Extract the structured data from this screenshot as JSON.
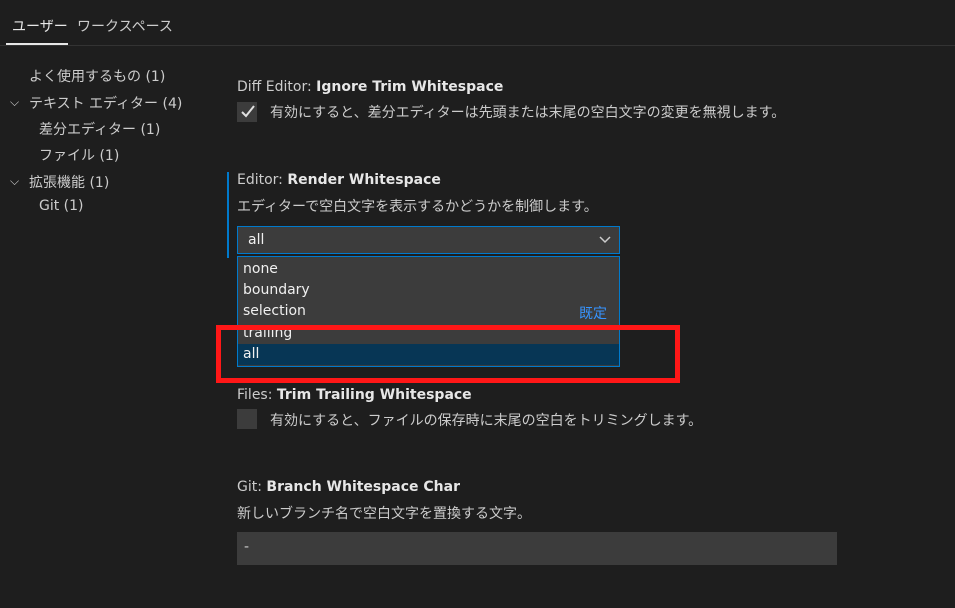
{
  "tabs": [
    {
      "label": "ユーザー",
      "active": true
    },
    {
      "label": "ワークスペース",
      "active": false
    }
  ],
  "tree": [
    {
      "label": "よく使用するもの (1)"
    },
    {
      "label": "テキスト エディター (4)",
      "expanded": true
    },
    {
      "label": "差分エディター (1)"
    },
    {
      "label": "ファイル (1)"
    },
    {
      "label": "拡張機能 (1)",
      "expanded": true
    },
    {
      "label": "Git (1)"
    }
  ],
  "settings": {
    "diff": {
      "category": "Diff Editor: ",
      "name": "Ignore Trim Whitespace",
      "checked": true,
      "description": "有効にすると、差分エディターは先頭または末尾の空白文字の変更を無視します。"
    },
    "render": {
      "category": "Editor: ",
      "name": "Render Whitespace",
      "description": "エディターで空白文字を表示するかどうかを制御します。",
      "value": "all",
      "options": [
        "none",
        "boundary",
        "selection",
        "trailing",
        "all"
      ],
      "default_label": "既定",
      "default_option": "selection"
    },
    "files": {
      "category": "Files: ",
      "name": "Trim Trailing Whitespace",
      "checked": false,
      "description": "有効にすると、ファイルの保存時に末尾の空白をトリミングします。"
    },
    "git": {
      "category": "Git: ",
      "name": "Branch Whitespace Char",
      "description": "新しいブランチ名で空白文字を置換する文字。",
      "value": "-"
    }
  },
  "colors": {
    "accent": "#007acc",
    "selected_option": "#073655",
    "highlight_box": "#ff1717",
    "default_label": "#3794ff"
  }
}
